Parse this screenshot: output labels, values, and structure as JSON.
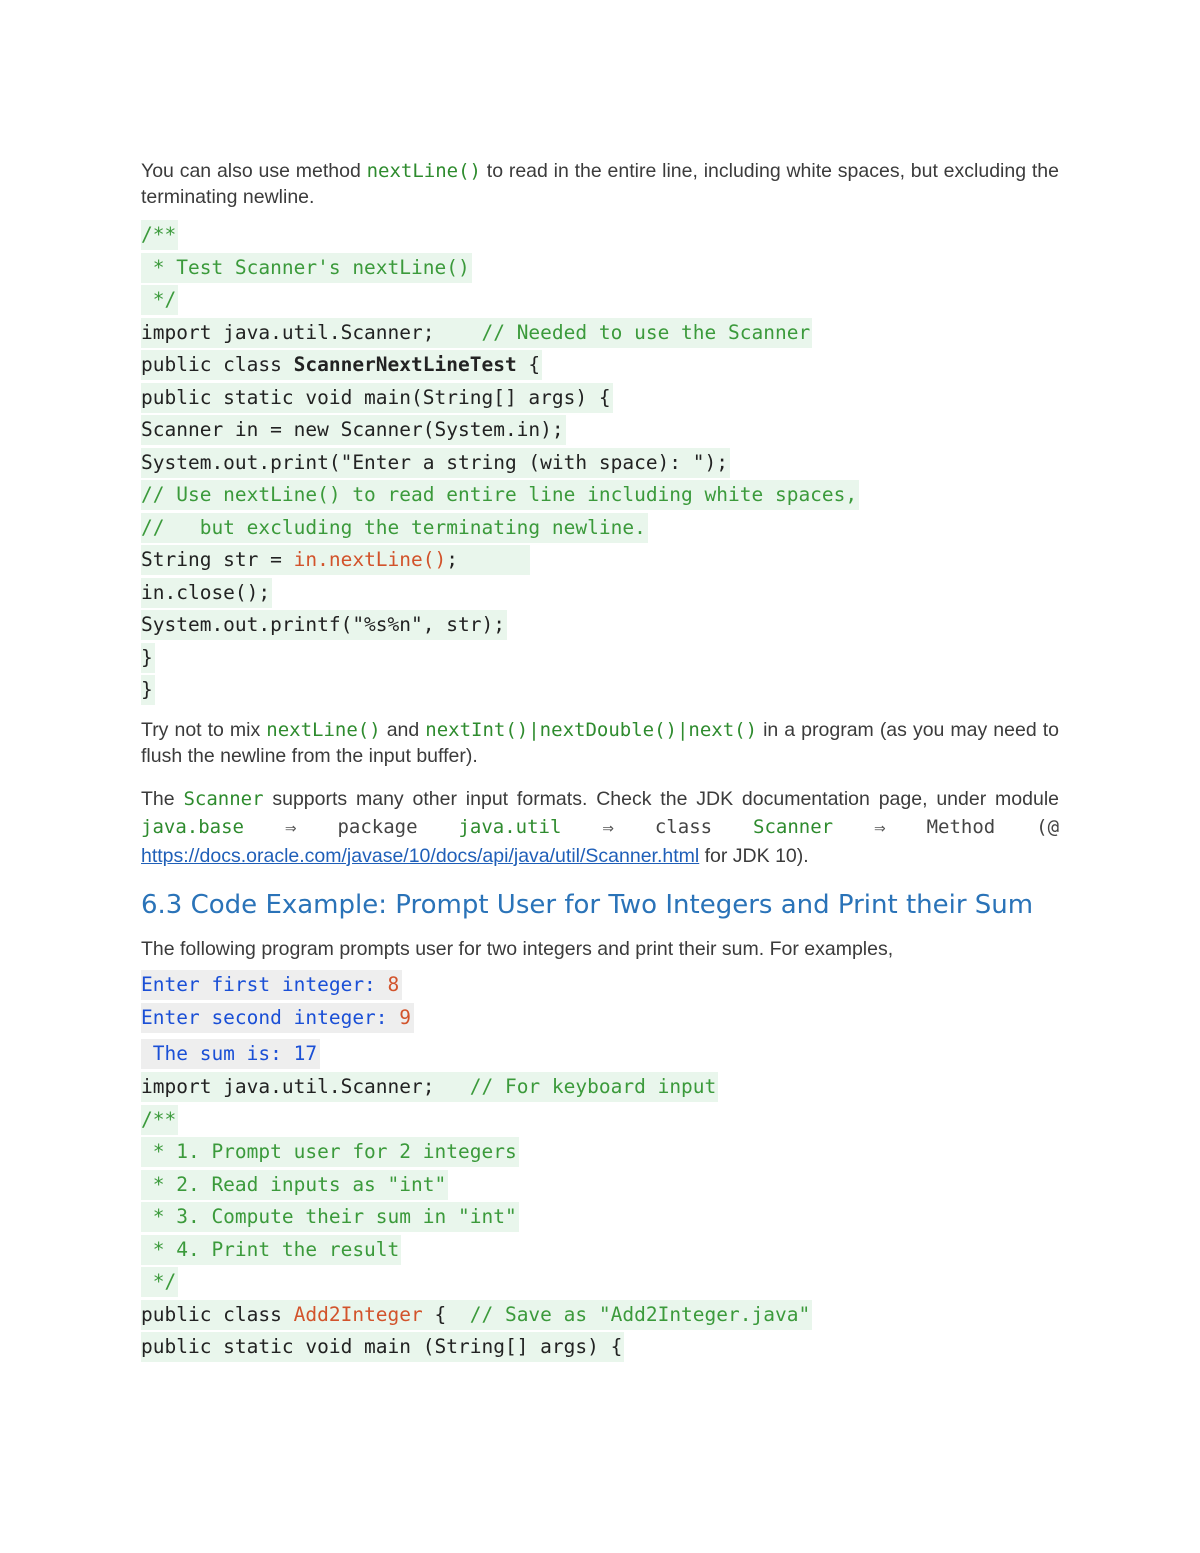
{
  "intro": {
    "p1_a": "You can also use method ",
    "p1_code": "nextLine()",
    "p1_b": " to read in the entire line, including white spaces, but excluding the terminating newline."
  },
  "code1": [
    {
      "indent": "",
      "parts": [
        {
          "t": "/**",
          "c": "cm"
        }
      ]
    },
    {
      "indent": "",
      "parts": [
        {
          "t": " * Test Scanner's nextLine()",
          "c": "cm"
        }
      ]
    },
    {
      "indent": "",
      "parts": [
        {
          "t": " */",
          "c": "cm"
        }
      ]
    },
    {
      "indent": "",
      "parts": [
        {
          "t": "import java.util.Scanner;    ",
          "c": ""
        },
        {
          "t": "// Needed to use the Scanner",
          "c": "cm"
        }
      ]
    },
    {
      "indent": "",
      "parts": [
        {
          "t": "public class ",
          "c": ""
        },
        {
          "t": "ScannerNextLineTest",
          "c": "bd"
        },
        {
          "t": " {",
          "c": ""
        }
      ]
    },
    {
      "indent": "   ",
      "parts": [
        {
          "t": "public static void main(String[] args) {",
          "c": ""
        }
      ]
    },
    {
      "indent": "      ",
      "parts": [
        {
          "t": "Scanner in = new Scanner(System.in);",
          "c": ""
        }
      ]
    },
    {
      "indent": "      ",
      "parts": [
        {
          "t": "System.out.print(\"Enter a string (with space): \");",
          "c": ""
        }
      ]
    },
    {
      "indent": "      ",
      "parts": [
        {
          "t": "// Use nextLine() to read entire line including white spaces,",
          "c": "cm"
        }
      ]
    },
    {
      "indent": "      ",
      "parts": [
        {
          "t": "//   but excluding the terminating newline.",
          "c": "cm"
        }
      ]
    },
    {
      "indent": "      ",
      "parts": [
        {
          "t": "String str = ",
          "c": ""
        },
        {
          "t": "in.nextLine()",
          "c": "rd"
        },
        {
          "t": ";      ",
          "c": ""
        }
      ]
    },
    {
      "indent": "      ",
      "parts": [
        {
          "t": "in.close();",
          "c": ""
        }
      ]
    },
    {
      "indent": "      ",
      "parts": [
        {
          "t": "System.out.printf(\"%s%n\", str);",
          "c": ""
        }
      ]
    },
    {
      "indent": "   ",
      "parts": [
        {
          "t": "}",
          "c": ""
        }
      ]
    },
    {
      "indent": " ",
      "parts": [
        {
          "t": "}",
          "c": ""
        }
      ]
    }
  ],
  "para2": {
    "a": "Try not to mix ",
    "c1": "nextLine()",
    "b": " and ",
    "c2": "nextInt()|nextDouble()|next()",
    "d": " in a program (as you may need to flush the newline from the input buffer)."
  },
  "para3": {
    "a": "The ",
    "c1": "Scanner",
    "b": " supports many other input formats. Check the JDK documentation page, under module ",
    "c2": "java.base",
    "arrow": "⇒",
    "c3": "package",
    "c4": "java.util",
    "c5": "class",
    "c6": "Scanner",
    "c7": "Method",
    "c8": "(@",
    "link": "https://docs.oracle.com/javase/10/docs/api/java/util/Scanner.html",
    "tail": " for JDK 10)."
  },
  "section": {
    "heading": "6.3  Code Example: Prompt User for Two Integers and Print their Sum",
    "intro": "The following program prompts user for two integers and print their sum. For examples,"
  },
  "output_sample": [
    {
      "prompt": "Enter first integer: ",
      "value": "8"
    },
    {
      "prompt": "Enter second integer: ",
      "value": "9"
    },
    {
      "prompt": " The sum is: 17",
      "value": ""
    }
  ],
  "code2": [
    {
      "indent": "",
      "parts": [
        {
          "t": "import java.util.Scanner;   ",
          "c": ""
        },
        {
          "t": "// For keyboard input",
          "c": "cm"
        }
      ]
    },
    {
      "indent": "",
      "parts": [
        {
          "t": "/**",
          "c": "cm"
        }
      ]
    },
    {
      "indent": "",
      "parts": [
        {
          "t": " * 1. Prompt user for 2 integers",
          "c": "cm"
        }
      ]
    },
    {
      "indent": "",
      "parts": [
        {
          "t": " * 2. Read inputs as \"int\"",
          "c": "cm"
        }
      ]
    },
    {
      "indent": "",
      "parts": [
        {
          "t": " * 3. Compute their sum in \"int\"",
          "c": "cm"
        }
      ]
    },
    {
      "indent": "",
      "parts": [
        {
          "t": " * 4. Print the result",
          "c": "cm"
        }
      ]
    },
    {
      "indent": "",
      "parts": [
        {
          "t": " */",
          "c": "cm"
        }
      ]
    },
    {
      "indent": "",
      "parts": [
        {
          "t": "public class ",
          "c": ""
        },
        {
          "t": "Add2Integer",
          "c": "rd"
        },
        {
          "t": " {  ",
          "c": ""
        },
        {
          "t": "// Save as \"Add2Integer.java\"",
          "c": "cm"
        }
      ]
    },
    {
      "indent": "   ",
      "parts": [
        {
          "t": "public static void main (String[] args) {",
          "c": ""
        }
      ]
    }
  ]
}
